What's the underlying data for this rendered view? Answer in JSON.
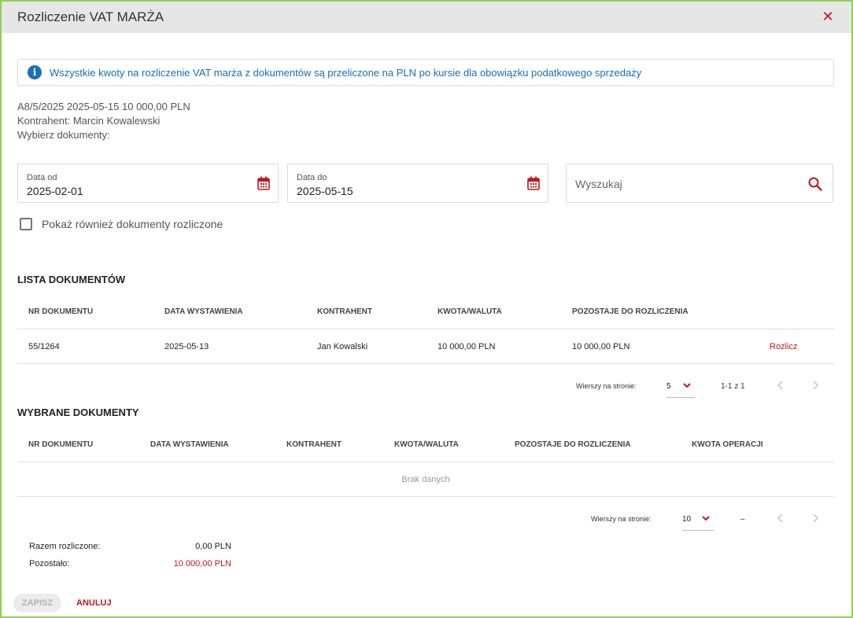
{
  "dialog": {
    "title": "Rozliczenie VAT MARŻA",
    "close_icon": "close-icon"
  },
  "info": {
    "icon": "info-icon",
    "icon_glyph": "i",
    "text": "Wszystkie kwoty na rozliczenie VAT marża z dokumentów są przeliczone na PLN po kursie dla obowiązku podatkowego sprzedaży"
  },
  "meta": {
    "document": "A8/5/2025 2025-05-15 10 000,00 PLN",
    "contractor": "Kontrahent: Marcin Kowalewski",
    "choose": "Wybierz dokumenty:"
  },
  "filters": {
    "date_from_label": "Data od",
    "date_from_value": "2025-02-01",
    "date_to_label": "Data do",
    "date_to_value": "2025-05-15",
    "search_placeholder": "Wyszukaj",
    "show_settled_label": "Pokaż również dokumenty rozliczone"
  },
  "documents_list": {
    "title": "LISTA DOKUMENTÓW",
    "columns": [
      "NR DOKUMENTU",
      "DATA WYSTAWIENIA",
      "KONTRAHENT",
      "KWOTA/WALUTA",
      "POZOSTAJE DO ROZLICZENIA"
    ],
    "rows": [
      {
        "number": "55/1264",
        "date": "2025-05-13",
        "contractor": "Jan Kowalski",
        "amount": "10 000,00 PLN",
        "remaining": "10 000,00 PLN",
        "action": "Rozlicz"
      }
    ],
    "pager": {
      "rows_label": "Wierszy na stronie:",
      "rows_value": "5",
      "range": "1-1 z 1"
    }
  },
  "selected_list": {
    "title": "WYBRANE DOKUMENTY",
    "columns": [
      "NR DOKUMENTU",
      "DATA WYSTAWIENIA",
      "KONTRAHENT",
      "KWOTA/WALUTA",
      "POZOSTAJE DO ROZLICZENIA",
      "KWOTA OPERACJI"
    ],
    "empty_text": "Brak danych",
    "pager": {
      "rows_label": "Wierszy na stronie:",
      "rows_value": "10",
      "range": "–"
    }
  },
  "totals": {
    "settled_label": "Razem rozliczone:",
    "settled_value": "0,00 PLN",
    "remaining_label": "Pozostało:",
    "remaining_value": "10 000,00 PLN"
  },
  "actions": {
    "save_label": "ZAPISZ",
    "cancel_label": "ANULUJ"
  },
  "colors": {
    "accent_red": "#c4161c",
    "info_blue": "#1a6fb5",
    "frame_green": "#8fd14f"
  }
}
